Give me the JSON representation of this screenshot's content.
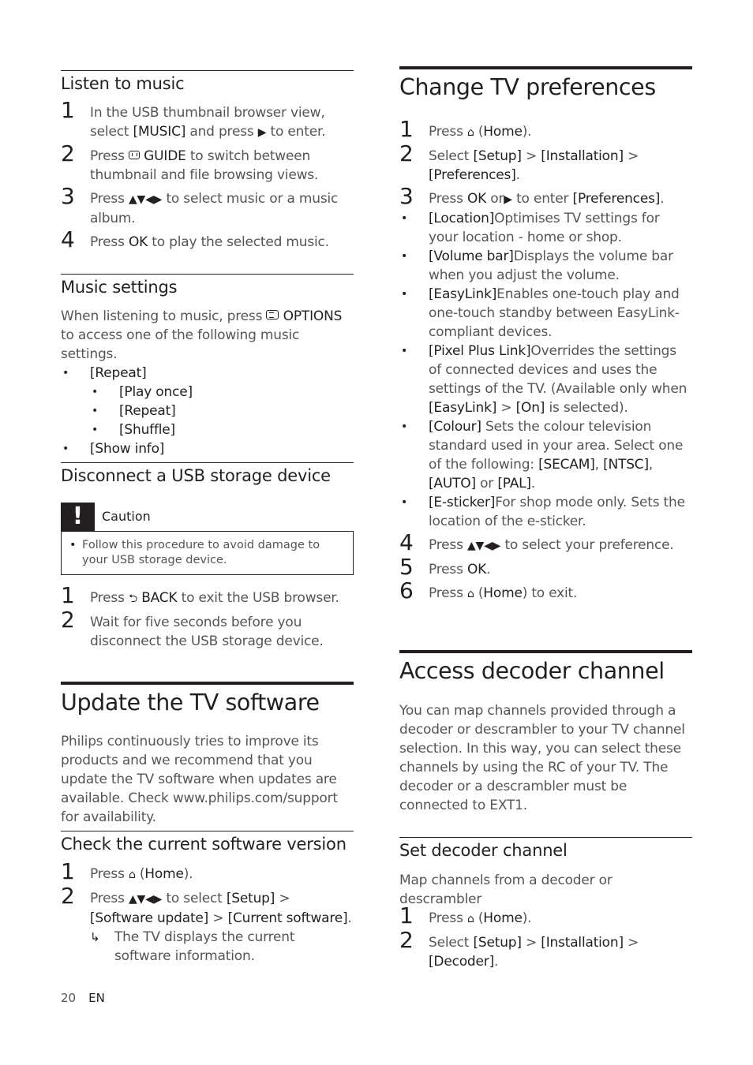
{
  "left": {
    "listen": {
      "heading": "Listen to music",
      "steps": [
        {
          "num": "1",
          "l1": "In the USB thumbnail browser view,",
          "l2a": "select ",
          "l2b": "[MUSIC]",
          "l2c": " and press ",
          "l2d": " to enter."
        },
        {
          "num": "2",
          "a": "Press ",
          "b": "GUIDE",
          "c": " to switch between thumbnail and file browsing views."
        },
        {
          "num": "3",
          "a": "Press ",
          "b": "▲▼◀▶",
          "c": " to select music or a music album."
        },
        {
          "num": "4",
          "a": "Press ",
          "b": "OK",
          "c": " to play the selected music."
        }
      ]
    },
    "music_settings": {
      "heading": "Music settings",
      "intro_a": "When listening to music, press ",
      "intro_b": "OPTIONS",
      "intro_c": " to access one of the following music settings.",
      "items": [
        "[Repeat]",
        "[Play once]",
        "[Repeat]",
        "[Shuffle]",
        "[Show info]"
      ]
    },
    "disconnect": {
      "heading": "Disconnect a USB storage device",
      "caution_title": "Caution",
      "caution_mark": "!",
      "caution_text": "Follow this procedure to avoid damage to your USB storage device.",
      "steps": [
        {
          "num": "1",
          "a": "Press ",
          "icon": "⮌",
          "b": "BACK",
          "c": " to exit the USB browser."
        },
        {
          "num": "2",
          "a": "Wait for five seconds before you disconnect the USB storage device."
        }
      ]
    },
    "update": {
      "heading": "Update the TV software",
      "body": "Philips continuously tries to improve its products and we recommend that you update the TV software when updates are available. Check www.philips.com/support for availability."
    },
    "check": {
      "heading": "Check the current software version",
      "steps": [
        {
          "num": "1",
          "a": "Press ",
          "icon": "⌂",
          "b": "(",
          "c": "Home",
          "d": ")."
        },
        {
          "num": "2",
          "a": "Press ",
          "b": "▲▼◀▶",
          "c": " to select ",
          "d": "[Setup]",
          "e": " > ",
          "f": "[Software update]",
          "g": " > ",
          "h": "[Current software]",
          "i": "."
        }
      ],
      "result_arrow": "↳",
      "result": "The TV displays the current software information."
    }
  },
  "right": {
    "prefs": {
      "heading": "Change TV preferences",
      "s1": {
        "num": "1",
        "a": "Press ",
        "icon": "⌂",
        "b": "(",
        "c": "Home",
        "d": ")."
      },
      "s2": {
        "num": "2",
        "a": "Select ",
        "b": "[Setup]",
        "c": " > ",
        "d": "[Installation]",
        "e": " > ",
        "f": "[Preferences]",
        "g": "."
      },
      "s3": {
        "num": "3",
        "a": "Press ",
        "b": "OK",
        "c": " or",
        "d": "▶",
        "e": " to enter ",
        "f": "[Preferences]",
        "g": "."
      },
      "options": [
        {
          "label": "[Location]",
          "text": "Optimises TV settings for your location - home or shop."
        },
        {
          "label": "[Volume bar]",
          "text": "Displays the volume bar when you adjust the volume."
        },
        {
          "label": "[EasyLink]",
          "text": "Enables one-touch play and one-touch standby between EasyLink-compliant devices."
        },
        {
          "label": "[Pixel Plus Link]",
          "text": "Overrides the settings of connected devices and uses the settings of the TV. (Available only when ",
          "b1": "[EasyLink]",
          "t2": " > ",
          "b2": "[On]",
          "t3": " is selected)."
        },
        {
          "label": "[Colour]",
          "text": " Sets the colour television standard used in your area. Select one of the following: ",
          "b1": "[SECAM]",
          "t2": ", ",
          "b2": "[NTSC]",
          "t3": ", ",
          "b3": "[AUTO]",
          "t4": " or ",
          "b4": "[PAL]",
          "t5": "."
        },
        {
          "label": "[E-sticker]",
          "text": "For shop mode only. Sets the location of the e-sticker."
        }
      ],
      "s4": {
        "num": "4",
        "a": "Press ",
        "b": "▲▼◀▶",
        "c": " to select your preference."
      },
      "s5": {
        "num": "5",
        "a": "Press ",
        "b": "OK",
        "c": "."
      },
      "s6": {
        "num": "6",
        "a": "Press ",
        "icon": "⌂",
        "b": "(",
        "c": "Home",
        "d": ") to exit."
      }
    },
    "decoder": {
      "heading": "Access decoder channel",
      "body": "You can map channels provided through a decoder or descrambler to your TV channel selection. In this way, you can select these channels by using the RC of your TV. The decoder or a descrambler must be connected to EXT1."
    },
    "set_decoder": {
      "heading": "Set decoder channel",
      "intro": "Map channels from a decoder or descrambler",
      "s1": {
        "num": "1",
        "a": "Press ",
        "icon": "⌂",
        "b": "(",
        "c": "Home",
        "d": ")."
      },
      "s2": {
        "num": "2",
        "a": "Select ",
        "b": "[Setup]",
        "c": " > ",
        "d": "[Installation]",
        "e": " > ",
        "f": "[Decoder]",
        "g": "."
      }
    }
  },
  "footer": {
    "page": "20",
    "lang": "EN"
  }
}
